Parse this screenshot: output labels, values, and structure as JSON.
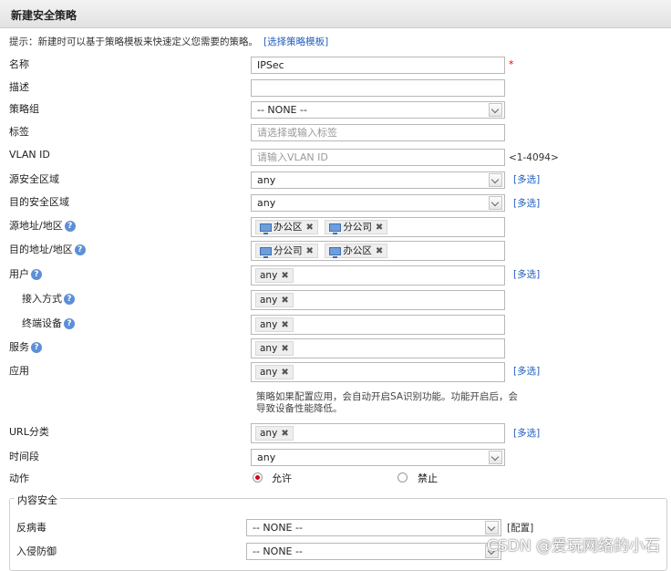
{
  "window": {
    "title": "新建安全策略"
  },
  "hint": {
    "text": "提示：新建时可以基于策略模板来快速定义您需要的策略。",
    "link": "[选择策略模板]"
  },
  "help_icon": "?",
  "colors": {
    "link": "#1f5fbf",
    "required": "#e00000",
    "radio_selected": "#d0021b"
  },
  "icons": {
    "dropdown": "chevron-down-icon",
    "help": "help-circle-icon",
    "address": "network-address-icon",
    "remove": "close-icon"
  },
  "form": {
    "name": {
      "label": "名称",
      "value": "IPSec",
      "required_mark": "*"
    },
    "description": {
      "label": "描述",
      "value": ""
    },
    "policy_group": {
      "label": "策略组",
      "value": "-- NONE --"
    },
    "tags": {
      "label": "标签",
      "placeholder": "请选择或输入标签"
    },
    "vlan": {
      "label": "VLAN ID",
      "placeholder": "请输入VLAN ID",
      "range": "<1-4094>"
    },
    "src_zone": {
      "label": "源安全区域",
      "value": "any",
      "multi": "[多选]"
    },
    "dst_zone": {
      "label": "目的安全区域",
      "value": "any",
      "multi": "[多选]"
    },
    "src_addr": {
      "label": "源地址/地区",
      "tags": [
        "办公区",
        "分公司"
      ]
    },
    "dst_addr": {
      "label": "目的地址/地区",
      "tags": [
        "分公司",
        "办公区"
      ]
    },
    "user": {
      "label": "用户",
      "tag": "any",
      "multi": "[多选]"
    },
    "access_mode": {
      "label": "接入方式",
      "tag": "any"
    },
    "terminal": {
      "label": "终端设备",
      "tag": "any"
    },
    "service": {
      "label": "服务",
      "tag": "any"
    },
    "application": {
      "label": "应用",
      "tag": "any",
      "multi": "[多选]",
      "note": "策略如果配置应用，会自动开启SA识别功能。功能开启后，会导致设备性能降低。"
    },
    "url_category": {
      "label": "URL分类",
      "tag": "any",
      "multi": "[多选]"
    },
    "time_range": {
      "label": "时间段",
      "value": "any"
    },
    "action": {
      "label": "动作",
      "allow": "允许",
      "deny": "禁止",
      "selected": "allow"
    }
  },
  "content_security": {
    "legend": "内容安全",
    "antivirus": {
      "label": "反病毒",
      "value": "-- NONE --",
      "config": "[配置]"
    },
    "ips": {
      "label": "入侵防御",
      "value": "-- NONE --"
    }
  },
  "watermark": "CSDN @爱玩网络的小石"
}
